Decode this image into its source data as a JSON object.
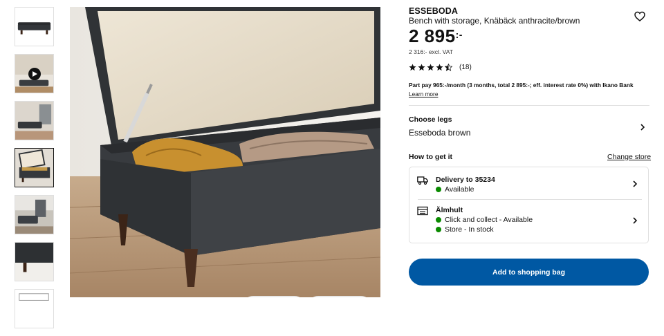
{
  "product": {
    "brand": "ESSEBODA",
    "description": "Bench with storage, Knäbäck anthracite/brown",
    "price_main": "2 895",
    "price_suffix": ":-",
    "price_excl_vat": "2 316:- excl. VAT",
    "rating_value": 4.5,
    "rating_stars_max": 5,
    "rating_count": "(18)"
  },
  "part_pay": {
    "text": "Part pay 965:-/month (3 months, total 2 895:-; eff. interest rate 0%) with Ikano Bank",
    "learn_more": "Learn more"
  },
  "legs": {
    "label": "Choose legs",
    "value": "Esseboda brown"
  },
  "get_it": {
    "label": "How to get it",
    "change_store": "Change store"
  },
  "delivery": {
    "title": "Delivery to 35234",
    "status": "Available"
  },
  "store": {
    "name": "Älmhult",
    "click_collect": "Click and collect - Available",
    "in_store": "Store - In stock"
  },
  "actions": {
    "add_to_bag": "Add to shopping bag"
  },
  "colors": {
    "primary_blue": "#0058a3",
    "available_green": "#0a8a00",
    "fabric": "#3a3d40",
    "wood": "#4a2e1f"
  },
  "icons": [
    "heart-icon",
    "chevron-right-icon",
    "truck-icon",
    "store-icon",
    "star-icon",
    "play-icon"
  ]
}
